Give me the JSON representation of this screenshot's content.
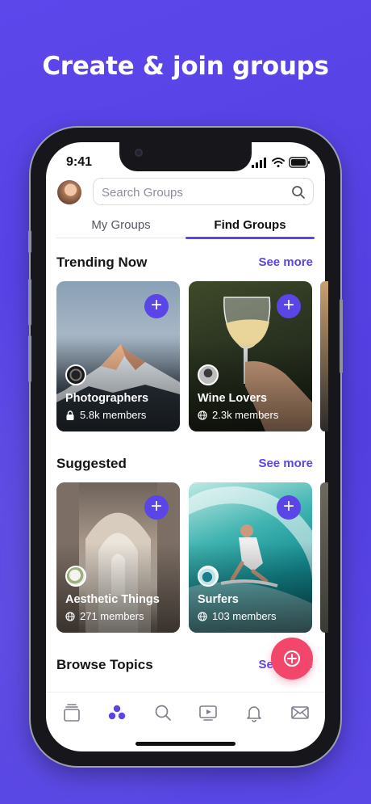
{
  "headline": "Create & join groups",
  "status": {
    "time": "9:41"
  },
  "search": {
    "placeholder": "Search Groups"
  },
  "tabs": [
    {
      "label": "My Groups",
      "active": false
    },
    {
      "label": "Find Groups",
      "active": true
    }
  ],
  "sections": {
    "trending": {
      "title": "Trending Now",
      "see_more": "See more"
    },
    "suggested": {
      "title": "Suggested",
      "see_more": "See more"
    },
    "browse": {
      "title": "Browse Topics",
      "see_more": "See more"
    }
  },
  "trending_groups": [
    {
      "name": "Photographers",
      "members": "5.8k members",
      "privacy": "lock-icon"
    },
    {
      "name": "Wine Lovers",
      "members": "2.3k members",
      "privacy": "globe-icon"
    }
  ],
  "suggested_groups": [
    {
      "name": "Aesthetic Things",
      "members": "271 members",
      "privacy": "globe-icon"
    },
    {
      "name": "Surfers",
      "members": "103 members",
      "privacy": "globe-icon"
    }
  ],
  "add_label": "+",
  "bottom_nav": [
    "feed-icon",
    "groups-icon",
    "search-icon",
    "video-icon",
    "bell-icon",
    "mail-icon"
  ],
  "colors": {
    "accent": "#5a45e6",
    "fab": "#f2466b",
    "background": "#5a45e6"
  }
}
